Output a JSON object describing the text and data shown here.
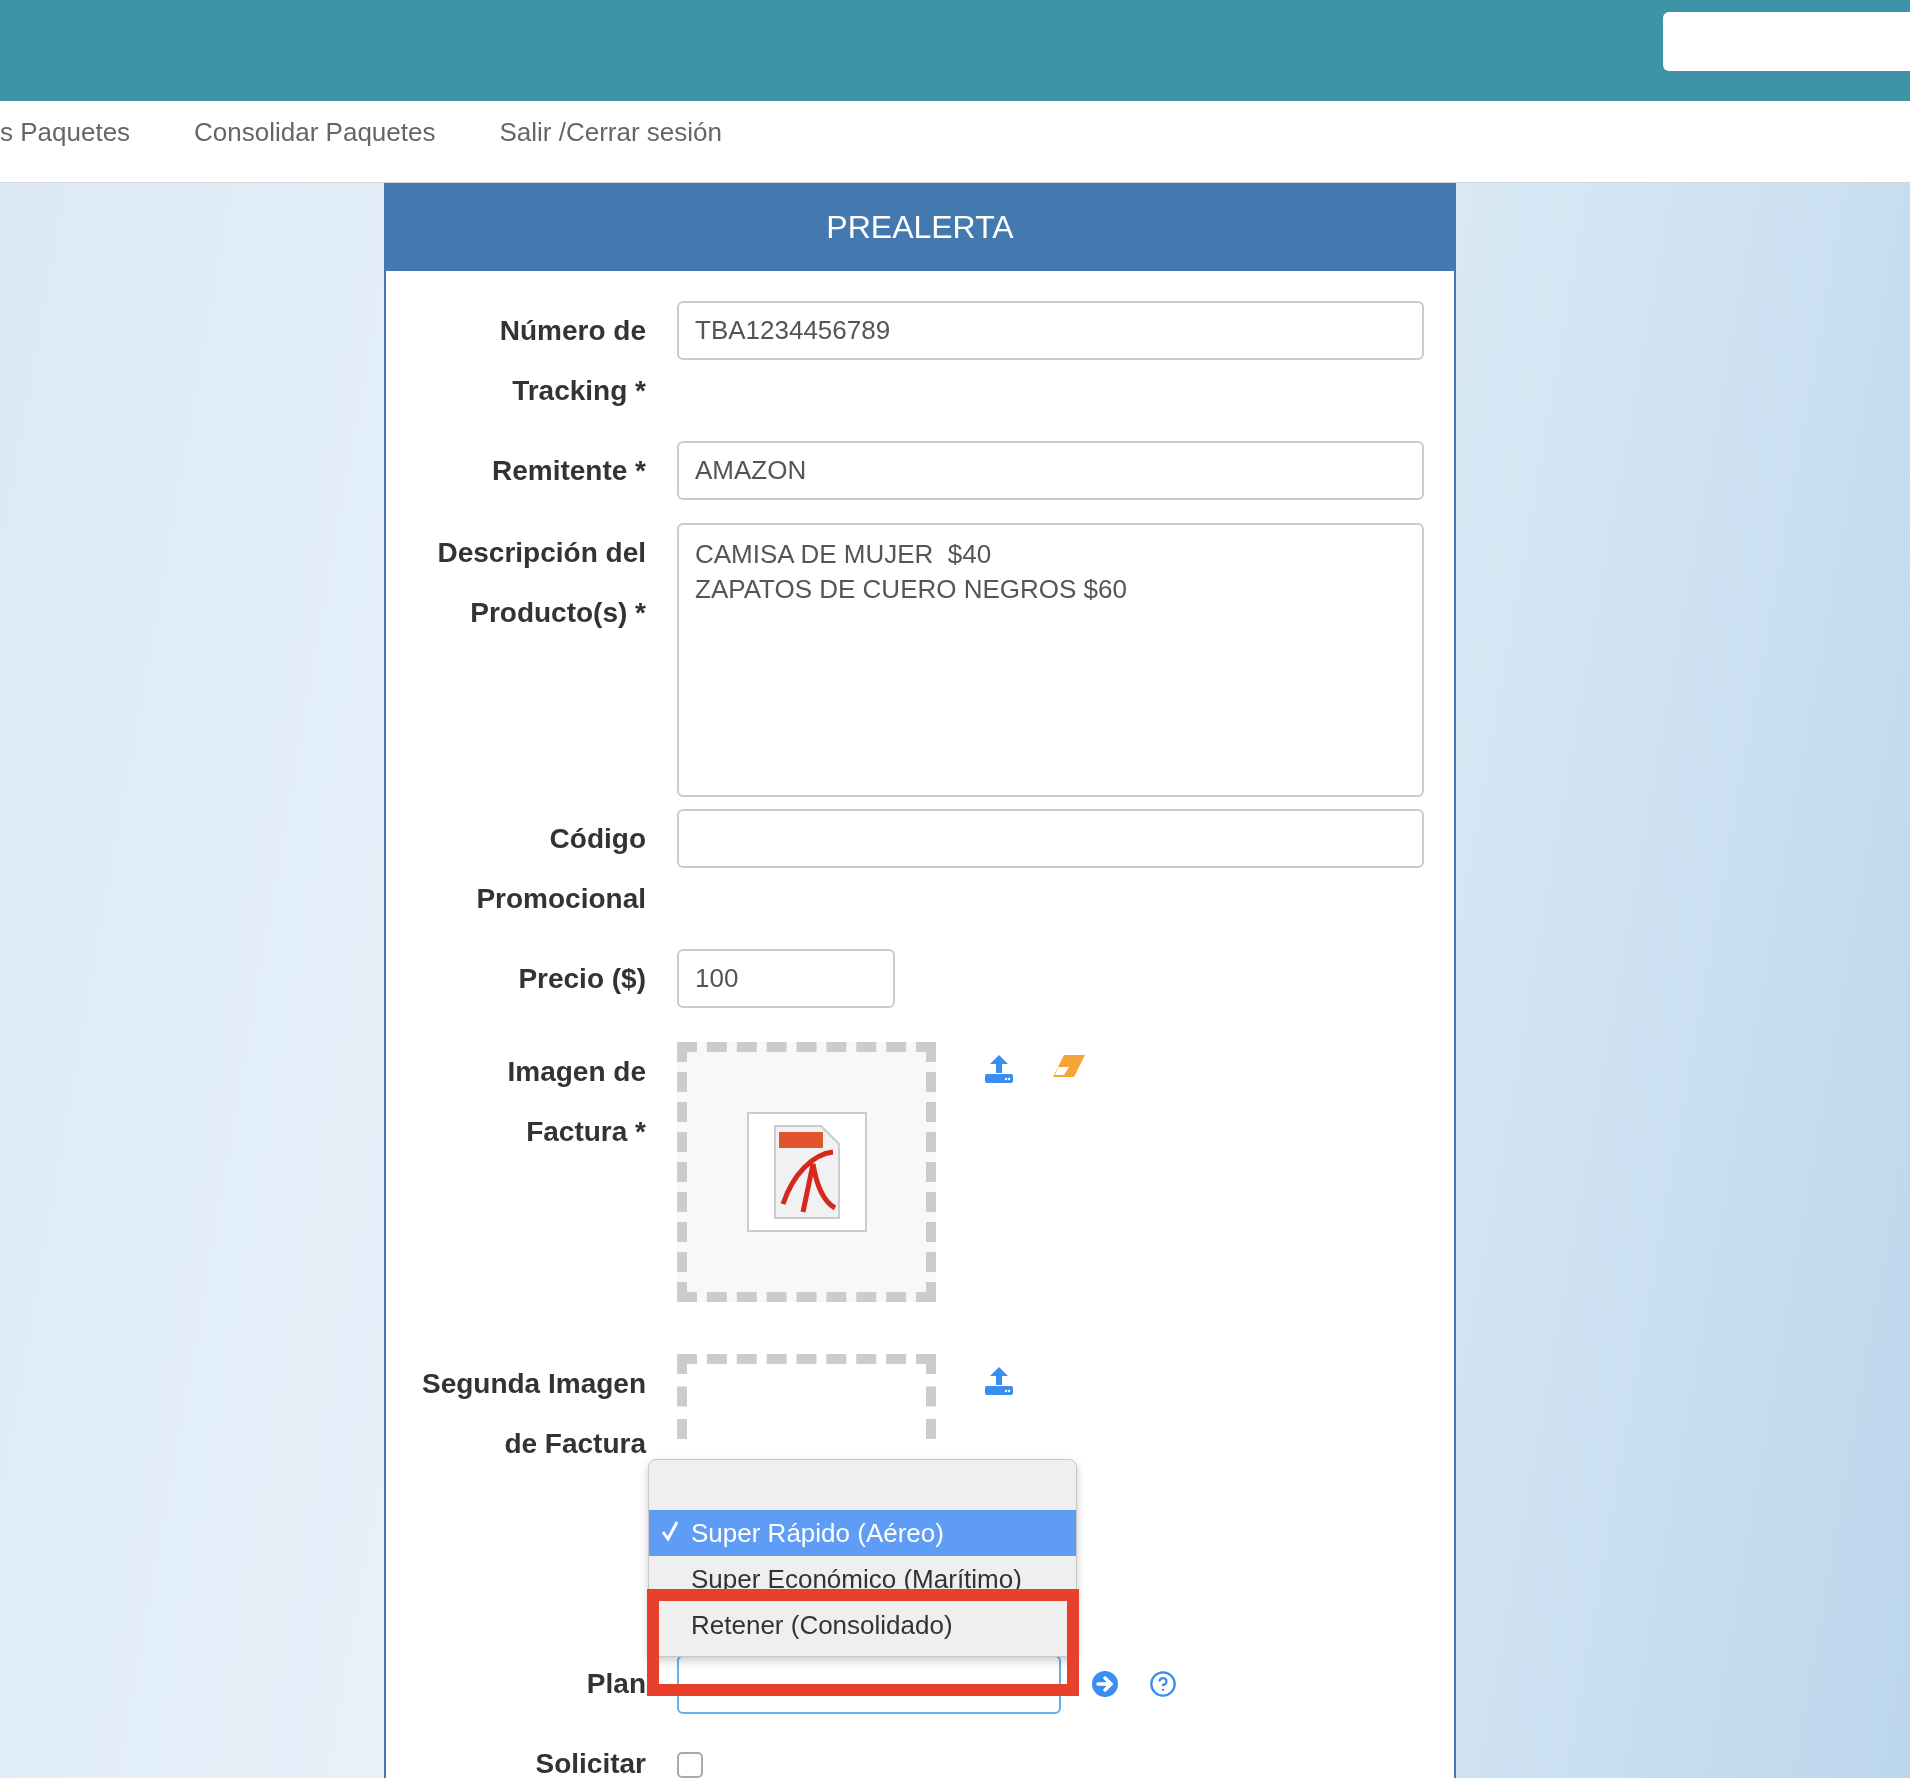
{
  "nav": [
    {
      "label": "s Paquetes"
    },
    {
      "label": "Consolidar Paquetes"
    },
    {
      "label": "Salir /Cerrar sesión"
    }
  ],
  "form": {
    "title": "PREALERTA",
    "fields": [
      {
        "kind": "text",
        "label_lines": [
          "Número de",
          "Tracking *"
        ],
        "value": "TBA1234456789"
      },
      {
        "kind": "text",
        "label_lines": [
          "Remitente *"
        ],
        "value": "AMAZON"
      },
      {
        "kind": "textarea",
        "label_lines": [
          "Descripción del",
          "Producto(s) *"
        ],
        "value": "CAMISA DE MUJER  $40\nZAPATOS DE CUERO NEGROS $60"
      },
      {
        "kind": "text",
        "label_lines": [
          "Código",
          "Promocional"
        ]
      },
      {
        "kind": "short",
        "label_lines": [
          "Precio ($)"
        ],
        "value": "100"
      },
      {
        "kind": "image",
        "label_lines": [
          "Imagen de",
          "Factura *"
        ],
        "has_file": true,
        "clear_button": true
      },
      {
        "kind": "image",
        "label_lines": [
          "Segunda Imagen",
          "de Factura"
        ],
        "has_file": false,
        "clear_button": false,
        "clipped": true
      },
      {
        "kind": "select",
        "label_lines": [
          "Plan"
        ],
        "open": true,
        "options": [
          {
            "label": "Super Rápido (Aéreo)",
            "selected": true,
            "highlight": false
          },
          {
            "label": "Super Económico (Marítimo)",
            "selected": false,
            "highlight": false
          },
          {
            "label": "Retener (Consolidado)",
            "selected": false,
            "highlight": true
          }
        ]
      },
      {
        "kind": "checkbox",
        "label_lines": [
          "Solicitar"
        ],
        "checked": false
      }
    ]
  }
}
